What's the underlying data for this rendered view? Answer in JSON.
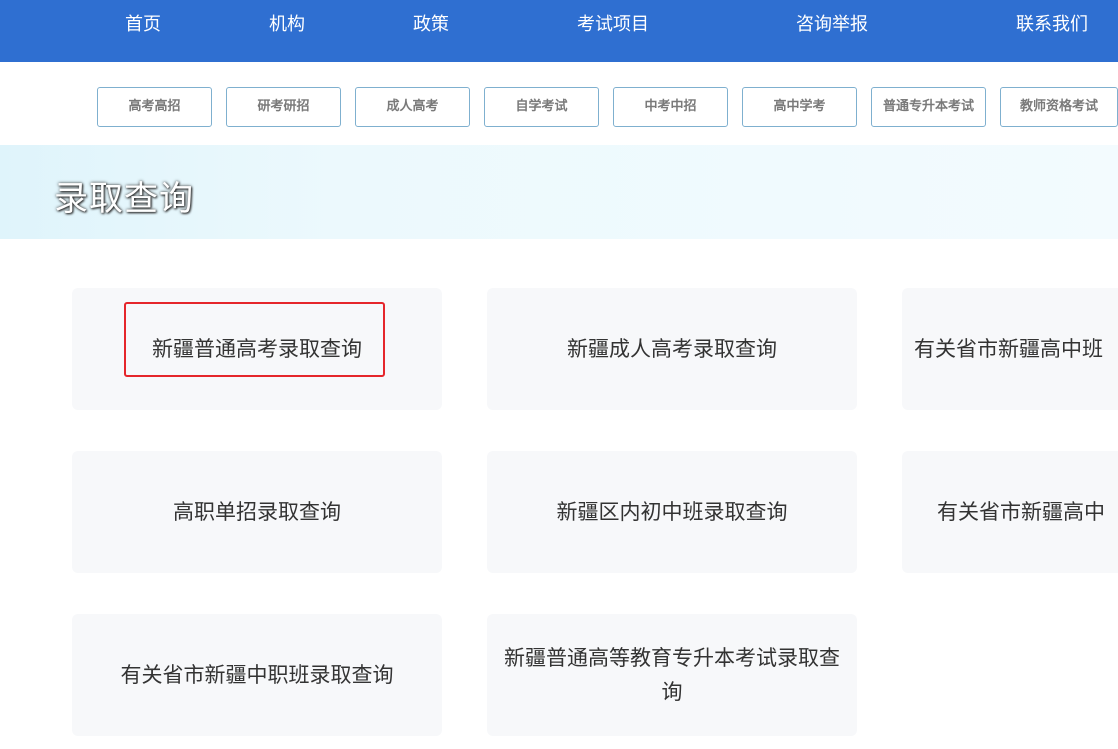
{
  "topnav": {
    "items": [
      "首页",
      "机构",
      "政策",
      "考试项目",
      "咨询举报",
      "联系我们"
    ]
  },
  "exam_nav": {
    "items": [
      "高考高招",
      "研考研招",
      "成人高考",
      "自学考试",
      "中考中招",
      "高中学考",
      "普通专升本考试",
      "教师资格考试"
    ]
  },
  "banner": {
    "title": "录取查询"
  },
  "cards": [
    "新疆普通高考录取查询",
    "新疆成人高考录取查询",
    "有关省市新疆高中班",
    "高职单招录取查询",
    "新疆区内初中班录取查询",
    "有关省市新疆高中",
    "有关省市新疆中职班录取查询",
    "新疆普通高等教育专升本考试录取查询"
  ],
  "colors": {
    "nav_bg": "#2f6fd1",
    "highlight": "#e5262b"
  }
}
